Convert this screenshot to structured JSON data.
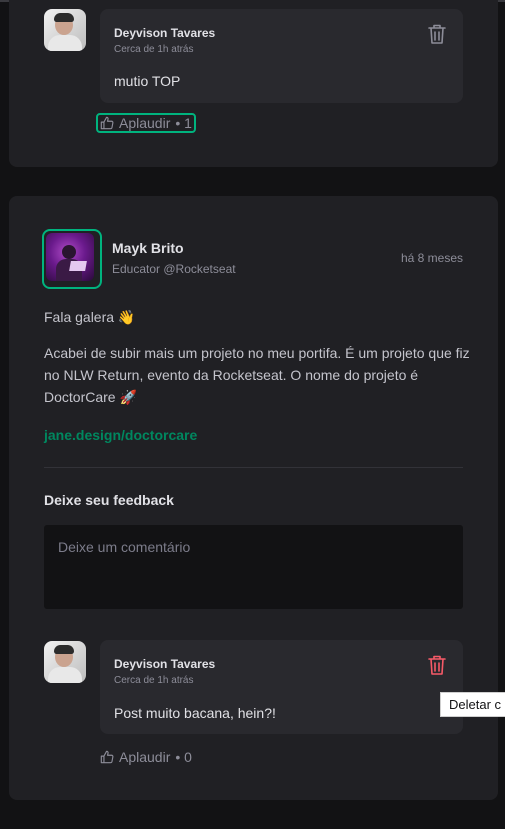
{
  "top_comment": {
    "author": "Deyvison Tavares",
    "time": "Cerca de 1h atrás",
    "text": "mutio TOP",
    "applaud_label": "Aplaudir",
    "applaud_count": "• 1"
  },
  "post": {
    "author_name": "Mayk Brito",
    "author_role": "Educator @Rocketseat",
    "time": "há 8 meses",
    "greeting": "Fala galera 👋",
    "body": "Acabei de subir mais um projeto no meu portifa. É um projeto que fiz no NLW Return, evento da Rocketseat. O nome do projeto é DoctorCare 🚀",
    "link": "jane.design/doctorcare"
  },
  "feedback": {
    "title": "Deixe seu feedback",
    "placeholder": "Deixe um comentário"
  },
  "bottom_comment": {
    "author": "Deyvison Tavares",
    "time": "Cerca de 1h atrás",
    "text": "Post muito bacana, hein?!",
    "applaud_label": "Aplaudir",
    "applaud_count": "• 0"
  },
  "tooltip": {
    "text": "Deletar c"
  },
  "colors": {
    "accent": "#00B37E",
    "link": "#00875F",
    "delete_hover": "#F75A68"
  },
  "icons": [
    "trash-icon",
    "thumbs-up-icon"
  ]
}
